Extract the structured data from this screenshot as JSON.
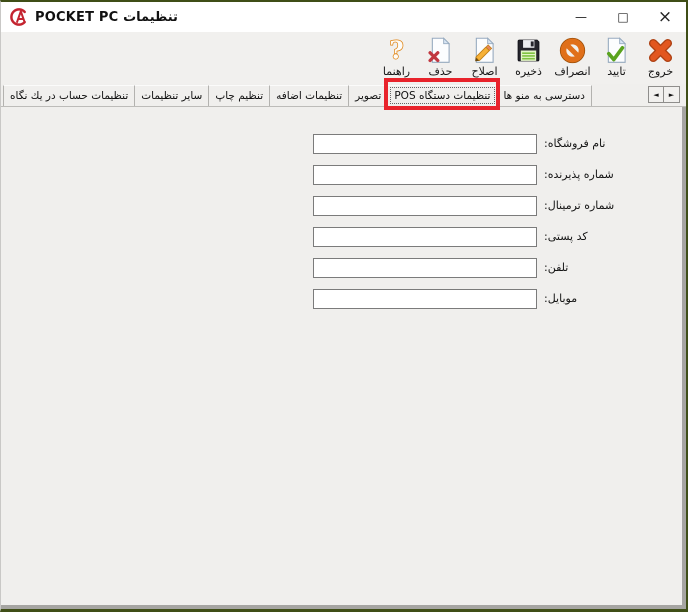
{
  "window": {
    "title": "POCKET PC تنظیمات",
    "logo_letters": "CA",
    "minimize_glyph": "—",
    "maximize_glyph": "□",
    "close_glyph": "×"
  },
  "toolbar": {
    "items": [
      {
        "label": "راهنما",
        "icon": "help-icon",
        "glyph": "?"
      },
      {
        "label": "حذف",
        "icon": "delete-icon"
      },
      {
        "label": "اصلاح",
        "icon": "edit-icon"
      },
      {
        "label": "ذخیره",
        "icon": "save-icon"
      },
      {
        "label": "انصراف",
        "icon": "cancel-icon"
      },
      {
        "label": "تایید",
        "icon": "confirm-icon"
      },
      {
        "label": "خروج",
        "icon": "exit-icon"
      }
    ]
  },
  "tabs": {
    "items": [
      {
        "label": "تنظیمات حساب در یك نگاه",
        "selected": false
      },
      {
        "label": "سایر تنظیمات",
        "selected": false
      },
      {
        "label": "تنظیم چاپ",
        "selected": false
      },
      {
        "label": "تنظیمات اضافه",
        "selected": false
      },
      {
        "label": "تصویر",
        "selected": false
      },
      {
        "label": "تنظیمات دستگاه POS",
        "selected": true
      },
      {
        "label": "دسترسی به منو ها",
        "selected": false
      }
    ],
    "selected_label": "تنظیمات دستگاه POS",
    "scroll_back_glyph": "◄",
    "scroll_forward_glyph": "►"
  },
  "form": {
    "fields": [
      {
        "label": "نام فروشگاه:",
        "value": ""
      },
      {
        "label": "شماره پذیرنده:",
        "value": ""
      },
      {
        "label": "شماره ترمینال:",
        "value": ""
      },
      {
        "label": "کد پستی:",
        "value": ""
      },
      {
        "label": "تلفن:",
        "value": ""
      },
      {
        "label": "موبایل:",
        "value": ""
      }
    ]
  },
  "colors": {
    "annotation_red": "#e8232b",
    "window_border_green": "#3f4e17",
    "titlebar_bg": "#ffffff",
    "toolbar_bg": "#f1f0ee",
    "content_bg": "#f0efed",
    "input_border": "#7b7b7b",
    "logo_red": "#c42430"
  }
}
